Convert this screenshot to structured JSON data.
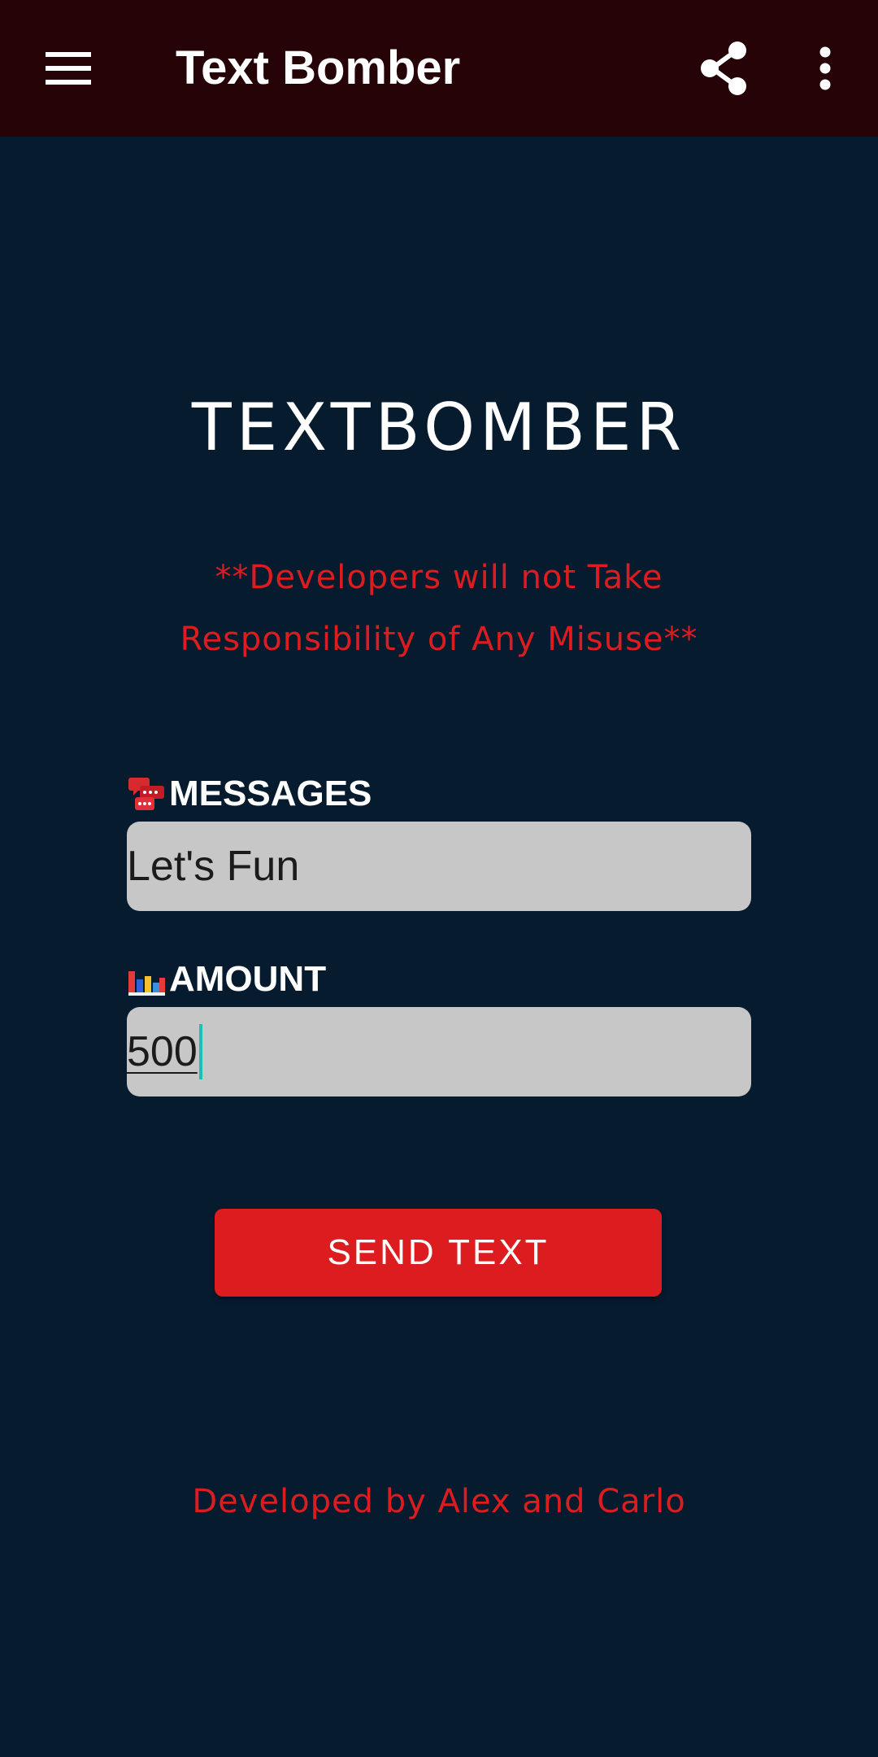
{
  "appbar": {
    "title": "Text Bomber",
    "background_color": "#250307",
    "icons": [
      "hamburger-menu-icon",
      "share-icon",
      "more-vert-icon"
    ]
  },
  "main": {
    "logo_text": "TEXTBOMBER",
    "disclaimer_line1": "**Developers will not Take",
    "disclaimer_line2": "Responsibility of Any Misuse**",
    "disclaimer_color": "#dd1c1f",
    "background_color": "#071b2f"
  },
  "form": {
    "messages": {
      "icon": "chat-bubbles-icon",
      "label": "MESSAGES",
      "value": "Let's Fun"
    },
    "amount": {
      "icon": "bar-chart-icon",
      "label": "AMOUNT",
      "value": "500"
    },
    "send_button_label": "SEND TEXT",
    "send_button_color": "#dd1c1f"
  },
  "footer": {
    "credit": "Developed by Alex and Carlo"
  }
}
